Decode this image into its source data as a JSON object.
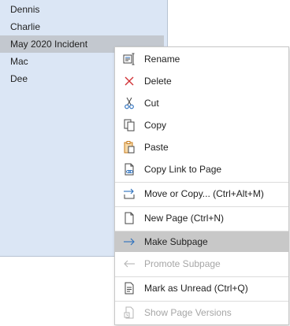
{
  "pages": {
    "items": [
      {
        "label": "Dennis",
        "selected": false
      },
      {
        "label": "Charlie",
        "selected": false
      },
      {
        "label": "May 2020 Incident",
        "selected": true
      },
      {
        "label": "Mac",
        "selected": false
      },
      {
        "label": "Dee",
        "selected": false
      }
    ]
  },
  "context_menu": {
    "items": [
      {
        "label": "Rename",
        "icon": "rename-icon",
        "enabled": true,
        "highlighted": false
      },
      {
        "label": "Delete",
        "icon": "delete-icon",
        "enabled": true,
        "highlighted": false
      },
      {
        "label": "Cut",
        "icon": "cut-icon",
        "enabled": true,
        "highlighted": false
      },
      {
        "label": "Copy",
        "icon": "copy-icon",
        "enabled": true,
        "highlighted": false
      },
      {
        "label": "Paste",
        "icon": "paste-icon",
        "enabled": true,
        "highlighted": false
      },
      {
        "label": "Copy Link to Page",
        "icon": "copy-link-icon",
        "enabled": true,
        "highlighted": false
      },
      {
        "label": "Move or Copy...  (Ctrl+Alt+M)",
        "icon": "move-copy-icon",
        "enabled": true,
        "highlighted": false
      },
      {
        "label": "New Page  (Ctrl+N)",
        "icon": "new-page-icon",
        "enabled": true,
        "highlighted": false
      },
      {
        "label": "Make Subpage",
        "icon": "arrow-right-icon",
        "enabled": true,
        "highlighted": true
      },
      {
        "label": "Promote Subpage",
        "icon": "arrow-left-icon",
        "enabled": false,
        "highlighted": false
      },
      {
        "label": "Mark as Unread  (Ctrl+Q)",
        "icon": "mark-unread-icon",
        "enabled": true,
        "highlighted": false
      },
      {
        "label": "Show Page Versions",
        "icon": "page-versions-icon",
        "enabled": false,
        "highlighted": false
      }
    ]
  },
  "colors": {
    "panel_bg": "#dbe6f5",
    "selected_bg": "#c3c8cf",
    "menu_highlight": "#c8c8c8",
    "delete_red": "#d13438",
    "accent_blue": "#2b6fbd",
    "paste_orange": "#c77c1e",
    "disabled_text": "#a6a6a6"
  }
}
